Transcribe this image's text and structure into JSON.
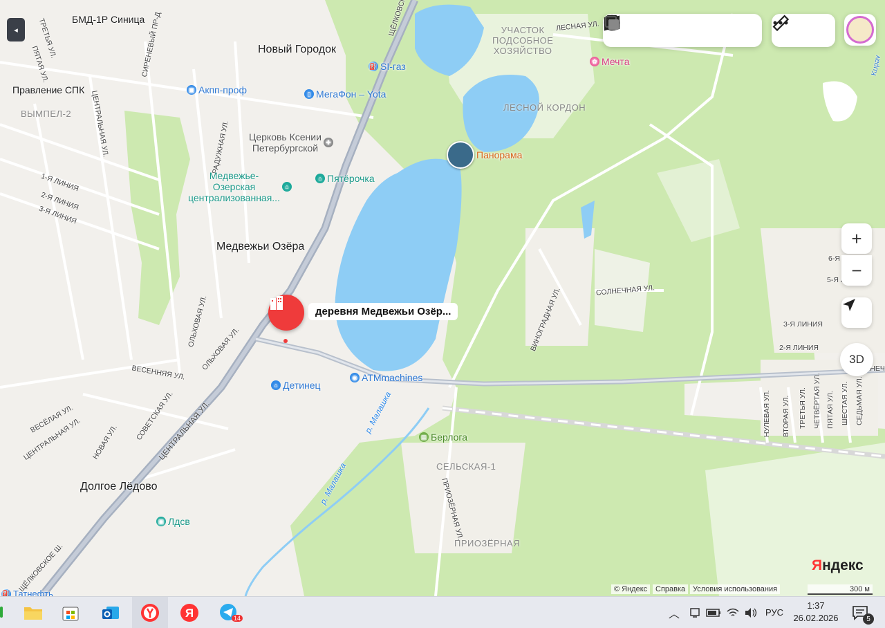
{
  "map": {
    "places": {
      "bmd": "БМД-1Р Синица",
      "new_town": "Новый Городок",
      "pravlenie": "Правление СПК",
      "medvezhi": "Медвежьи Озёра",
      "dolgoe": "Долгое Лёдово",
      "vympel": "ВЫМПЕЛ-2",
      "uchastok": "УЧАСТОК\nПОДСОБНОЕ\nХОЗЯЙСТВО",
      "lesnoy_kordon": "ЛЕСНОЙ КОРДОН",
      "selskaya": "СЕЛЬСКАЯ-1",
      "priozernaya": "ПРИОЗЁРНАЯ"
    },
    "pois": {
      "akpp": "Акпп-проф",
      "megafon": "МегаФон – Yota",
      "si_gaz": "SI-газ",
      "church": "Церковь Ксении\nПетербургской",
      "school": "Медвежье-\nОзерская\nцентрализованная...",
      "pyaterochka": "Пятёрочка",
      "mechta": "Мечта",
      "panorama": "Панорама",
      "detinets": "Детинец",
      "atm": "ATMmachines",
      "berloga": "Берлога",
      "ldsv": "Лдсв",
      "tatneft": "Татнефть"
    },
    "selected": "деревня Медвежьи Озёр...",
    "rivers": {
      "malashka1": "р. Малашка",
      "malashka2": "р. Малашка"
    },
    "streets": {
      "shchelkovo_top": "ЩЁЛКОВСКОЕ",
      "shchelkovo_bottom": "ЩЁЛКОВСКОЕ Ш.",
      "lesnaya": "ЛЕСНАЯ УЛ.",
      "centralnaya_main": "ЦЕНТРАЛЬНАЯ УЛ.",
      "centralnaya_left": "ЦЕНТРАЛЬНАЯ УЛ.",
      "centralnaya_vert": "ЦЕНТРАЛЬНАЯ УЛ.",
      "sovetskaya": "СОВЕТСКАЯ УЛ.",
      "vesennyaya": "ВЕСЕННЯЯ УЛ.",
      "novaya": "НОВАЯ УЛ.",
      "veselaya": "ВЕСЁЛАЯ УЛ.",
      "olhovaya": "ОЛЬХОВАЯ УЛ.",
      "olhovaya2": "ОЛЬХОВАЯ УЛ.",
      "raduzhnaya": "РАДУЖНАЯ УЛ.",
      "sirenevy": "СИРЕНЕВЫЙ ПР-Д",
      "tretya": "ТРЕТЬЯ УЛ.",
      "pyataya": "ПЯТАЯ УЛ.",
      "solnechnaya": "СОЛНЕЧНАЯ УЛ.",
      "vinogradnaya": "ВИНОГРАДНАЯ УЛ.",
      "priozernaya_ul": "ПРИОЗЁРНАЯ УЛ.",
      "liniya1": "1-Я ЛИНИЯ",
      "liniya2": "2-Я ЛИНИЯ",
      "liniya3": "3-Я ЛИНИЯ",
      "liniya_r3": "3-Я ЛИНИЯ",
      "liniya_r2": "2-Я ЛИНИЯ",
      "liniya_r5": "5-Я Л",
      "liniya_r6": "6-Я Л",
      "nulevaya": "НУЛЕВАЯ УЛ.",
      "vtoraya": "ВТОРАЯ УЛ.",
      "tretya_r": "ТРЕТЬЯ УЛ.",
      "chetvertaya": "ЧЕТВЁРТАЯ УЛ.",
      "pyataya_r": "ПЯТАЯ УЛ.",
      "shestaya": "ШЕСТАЯ УЛ.",
      "sedmaya": "СЕДЬМАЯ УЛ.",
      "solnech_r": "СОЛНЕЧ",
      "kupav": "Kupav"
    }
  },
  "toolbar": {
    "icons": [
      "layers-icon",
      "map-book-icon",
      "camera-icon",
      "bus-icon",
      "square-icon"
    ],
    "tools": [
      "ruler-icon",
      "more-icon"
    ]
  },
  "controls": {
    "zoom_in": "+",
    "zoom_out": "−",
    "three_d": "3D",
    "collapse": "◂"
  },
  "footer": {
    "logo": "Яндекс",
    "copyright": "© Яндекс",
    "help": "Справка",
    "terms": "Условия использования",
    "scale": "300 м"
  },
  "taskbar": {
    "lang": "РУС",
    "time": "1:37",
    "date": "26.02.2026",
    "telegram_badge": "14",
    "notif_count": "5"
  },
  "colors": {
    "water": "#8ecdf5",
    "forest": "#cbe8ad",
    "road_main": "#a6b0c0",
    "accent_red": "#ee3d3d"
  }
}
